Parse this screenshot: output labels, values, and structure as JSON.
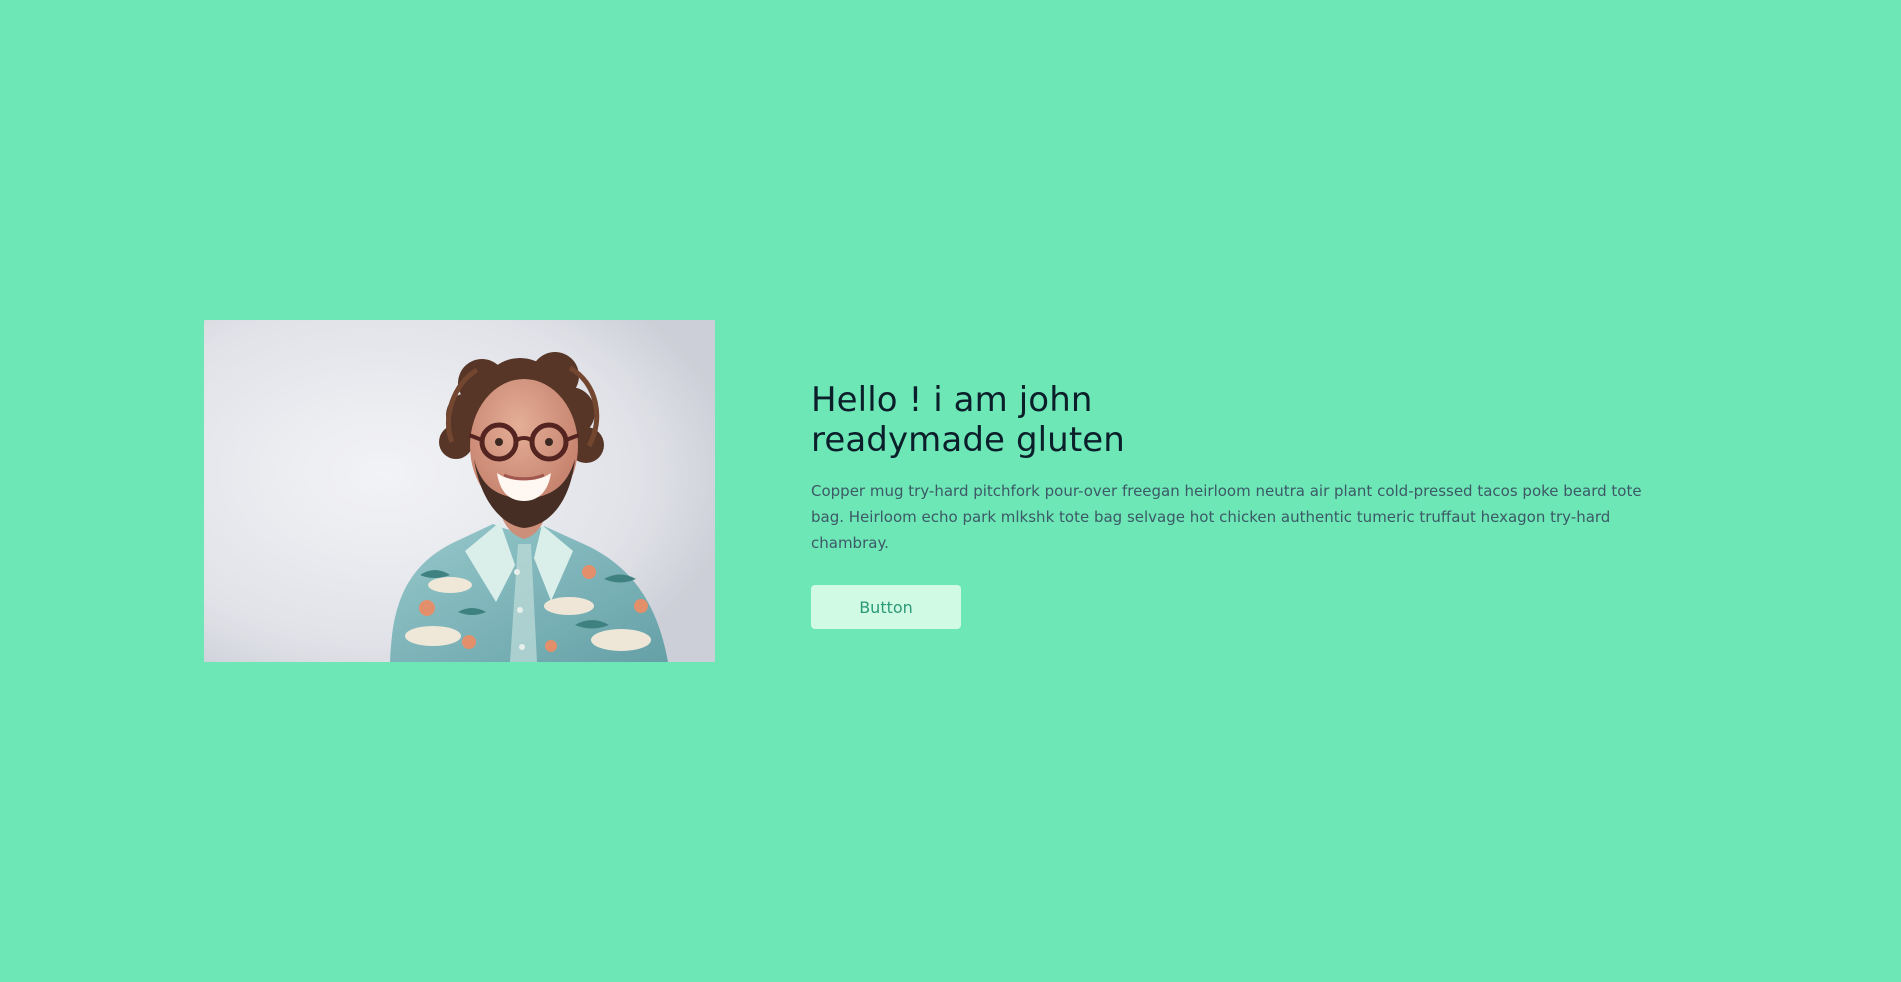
{
  "hero": {
    "image_alt": "Smiling man with curly hair, glasses and a patterned shirt",
    "title_line_1": "Hello ! i am john",
    "title_line_2": "readymade gluten",
    "description": "Copper mug try-hard pitchfork pour-over freegan heirloom neutra air plant cold-pressed tacos poke beard tote bag. Heirloom echo park mlkshk tote bag selvage hot chicken authentic tumeric truffaut hexagon try-hard chambray.",
    "button_label": "Button"
  },
  "colors": {
    "page_background": "#6ee7b7",
    "heading": "#0b1f2a",
    "body_text": "#3b5966",
    "button_background": "#d1fae5",
    "button_text": "#2b9a76"
  }
}
